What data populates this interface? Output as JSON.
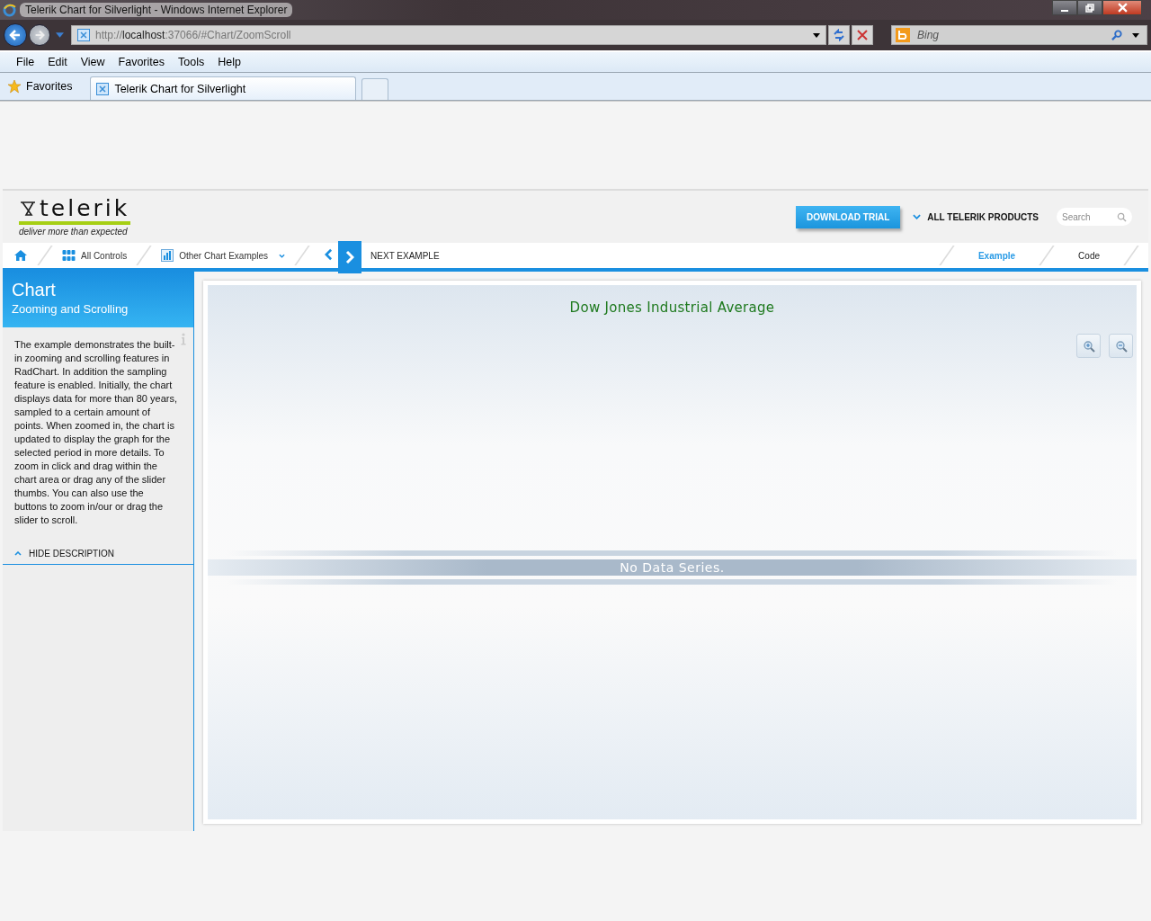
{
  "window": {
    "title": "Telerik Chart for Silverlight - Windows Internet Explorer"
  },
  "address_bar": {
    "scheme": "http://",
    "host": "localhost",
    "rest": ":37066/#Chart/ZoomScroll"
  },
  "search_box": {
    "placeholder": "Bing"
  },
  "menu": [
    "File",
    "Edit",
    "View",
    "Favorites",
    "Tools",
    "Help"
  ],
  "favorites_bar": {
    "label": "Favorites"
  },
  "tabs": [
    {
      "label": "Telerik Chart for Silverlight",
      "selected": true
    }
  ],
  "page": {
    "header": {
      "logo": "telerik",
      "tagline": "deliver more than expected",
      "download_button": "DOWNLOAD TRIAL",
      "products_link": "ALL TELERIK PRODUCTS",
      "search_placeholder": "Search"
    },
    "nav": {
      "all_controls": "All Controls",
      "other_examples": "Other Chart Examples",
      "next_example": "NEXT EXAMPLE"
    },
    "view_tabs": [
      {
        "label": "Example",
        "selected": true
      },
      {
        "label": "Code",
        "selected": false
      }
    ],
    "sidebar": {
      "title": "Chart",
      "subtitle": "Zooming and Scrolling",
      "description": "The example demonstrates the built-in zooming and scrolling features in RadChart. In addition the sampling feature is enabled. Initially, the chart displays data for more than 80 years, sampled to a certain amount of points. When zoomed in, the chart is updated to display the graph for the selected period in more details. To zoom in click and drag within the chart area or drag any of the slider thumbs. You can also use the buttons to zoom in/our or drag the slider to scroll.",
      "hide_link": "HIDE DESCRIPTION"
    },
    "chart": {
      "title": "Dow Jones Industrial Average",
      "message": "No Data Series."
    }
  }
}
